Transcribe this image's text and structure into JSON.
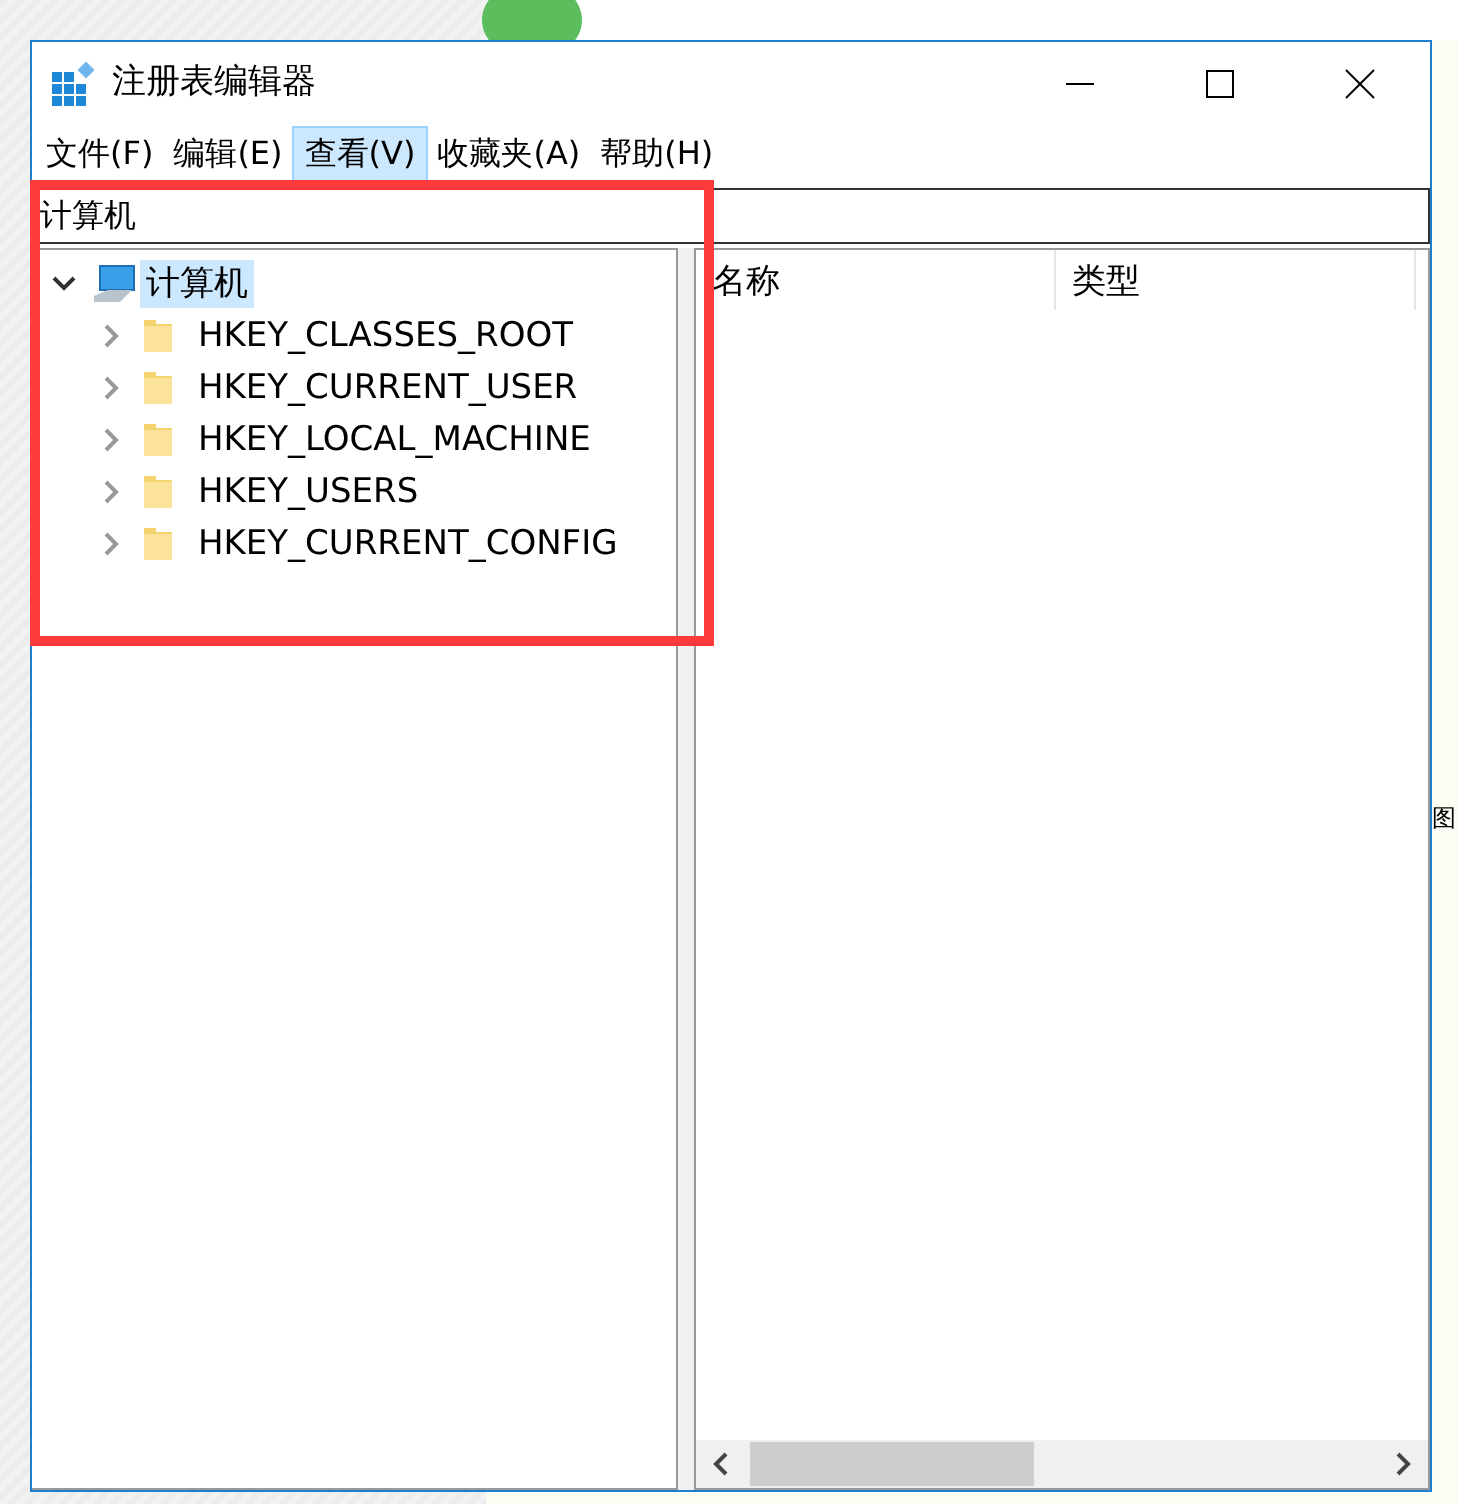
{
  "window": {
    "title": "注册表编辑器"
  },
  "menu": [
    {
      "label": "文件(F)",
      "selected": false
    },
    {
      "label": "编辑(E)",
      "selected": false
    },
    {
      "label": "查看(V)",
      "selected": true
    },
    {
      "label": "收藏夹(A)",
      "selected": false
    },
    {
      "label": "帮助(H)",
      "selected": false
    }
  ],
  "address_bar": {
    "value": "计算机"
  },
  "tree": [
    {
      "label": "计算机",
      "expanded": true,
      "selected": true,
      "children": [
        {
          "label": "HKEY_CLASSES_ROOT",
          "expanded": false,
          "selected": false
        },
        {
          "label": "HKEY_CURRENT_USER",
          "expanded": false,
          "selected": false
        },
        {
          "label": "HKEY_LOCAL_MACHINE",
          "expanded": false,
          "selected": false
        },
        {
          "label": "HKEY_USERS",
          "expanded": false,
          "selected": false
        },
        {
          "label": "HKEY_CURRENT_CONFIG",
          "expanded": false,
          "selected": false
        }
      ]
    }
  ],
  "list": {
    "columns": [
      "名称",
      "类型"
    ]
  },
  "background": {
    "text": "图"
  },
  "annotation": {
    "kind": "rectangle"
  }
}
